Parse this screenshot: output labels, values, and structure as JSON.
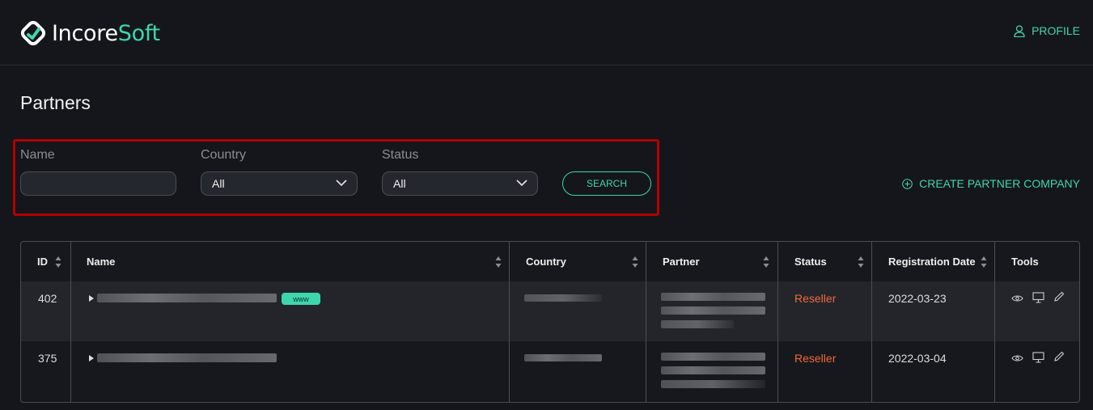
{
  "header": {
    "logo_text_white": "Incore",
    "logo_text_green": "Soft",
    "profile_label": "PROFILE"
  },
  "page": {
    "title": "Partners"
  },
  "filters": {
    "name_label": "Name",
    "name_value": "",
    "country_label": "Country",
    "country_value": "All",
    "status_label": "Status",
    "status_value": "All",
    "search_label": "SEARCH"
  },
  "actions": {
    "create_label": "CREATE PARTNER COMPANY"
  },
  "table": {
    "columns": [
      "ID",
      "Name",
      "Country",
      "Partner",
      "Status",
      "Registration Date",
      "Tools"
    ],
    "rows": [
      {
        "id": "402",
        "badge": "www",
        "status": "Reseller",
        "date": "2022-03-23"
      },
      {
        "id": "375",
        "badge": "",
        "status": "Reseller",
        "date": "2022-03-04"
      }
    ]
  },
  "colors": {
    "accent": "#3ed6ad",
    "status": "#f0693c",
    "highlight": "#b30000",
    "background": "#15161b"
  },
  "icons": [
    "logo-icon",
    "user-icon",
    "chevron-down-icon",
    "plus-circle-icon",
    "sort-icon",
    "eye-icon",
    "monitor-icon",
    "pencil-icon"
  ]
}
